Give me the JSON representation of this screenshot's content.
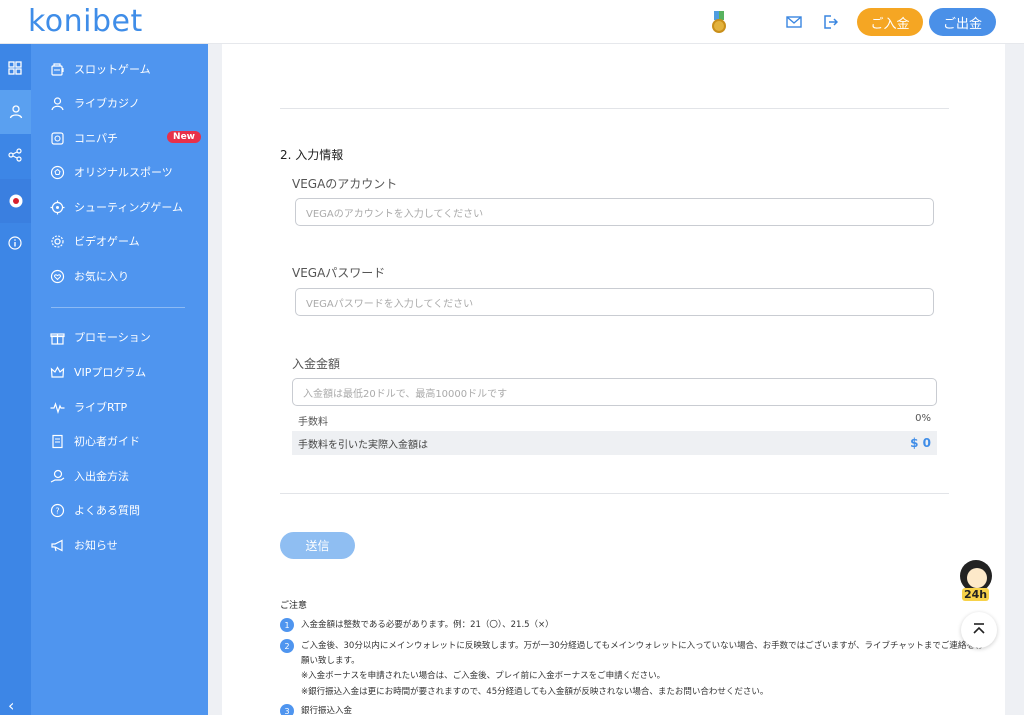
{
  "header": {
    "logo": "konibet",
    "deposit_label": "ご入金",
    "withdraw_label": "ご出金"
  },
  "sidebar": {
    "items": [
      {
        "label": "スロットゲーム",
        "icon": "slot-machine-icon"
      },
      {
        "label": "ライブカジノ",
        "icon": "dealer-icon"
      },
      {
        "label": "コニパチ",
        "icon": "pachinko-icon",
        "badge": "New"
      },
      {
        "label": "オリジナルスポーツ",
        "icon": "soccer-ball-icon"
      },
      {
        "label": "シューティングゲーム",
        "icon": "crosshair-icon"
      },
      {
        "label": "ビデオゲーム",
        "icon": "gear-game-icon"
      },
      {
        "label": "お気に入り",
        "icon": "heart-icon"
      },
      {
        "label": "プロモーション",
        "icon": "gift-icon"
      },
      {
        "label": "VIPプログラム",
        "icon": "crown-icon"
      },
      {
        "label": "ライブRTP",
        "icon": "pulse-icon"
      },
      {
        "label": "初心者ガイド",
        "icon": "guide-book-icon"
      },
      {
        "label": "入出金方法",
        "icon": "money-hand-icon"
      },
      {
        "label": "よくある質問",
        "icon": "question-icon"
      },
      {
        "label": "お知らせ",
        "icon": "megaphone-icon"
      }
    ]
  },
  "form": {
    "section_title": "2. 入力情報",
    "account_label": "VEGAのアカウント",
    "account_placeholder": "VEGAのアカウントを入力してください",
    "password_label": "VEGAパスワード",
    "password_placeholder": "VEGAパスワードを入力してください",
    "amount_label": "入金金額",
    "amount_placeholder": "入金額は最低20ドルで、最高10000ドルです",
    "fee_label": "手数料",
    "fee_value": "0%",
    "net_label": "手数料を引いた実際入金額は",
    "net_value": "$ 0",
    "submit_label": "送信"
  },
  "notes": {
    "title": "ご注意",
    "items": [
      {
        "num": "1",
        "text": "入金金額は整数である必要があります。例：21（〇）、21.5（×）"
      },
      {
        "num": "2",
        "text": "ご入金後、30分以内にメインウォレットに反映致します。万が一30分経過してもメインウォレットに入っていない場合、お手数ではございますが、ライブチャットまでご連絡をお願い致します。"
      },
      {
        "num": "",
        "text": "※入金ボーナスを申請されたい場合は、ご入金後、プレイ前に入金ボーナスをご申請ください。"
      },
      {
        "num": "",
        "text": "※銀行振込入金は更にお時間が要されますので、45分経過しても入金額が反映されない場合、またお問い合わせください。"
      },
      {
        "num": "3",
        "text": "銀行振込入金"
      }
    ]
  },
  "support": {
    "badge": "24h"
  },
  "colors": {
    "primary": "#4f95ef",
    "deposit": "#f5a623",
    "withdraw": "#4a90e8",
    "new_badge": "#e8304a"
  }
}
